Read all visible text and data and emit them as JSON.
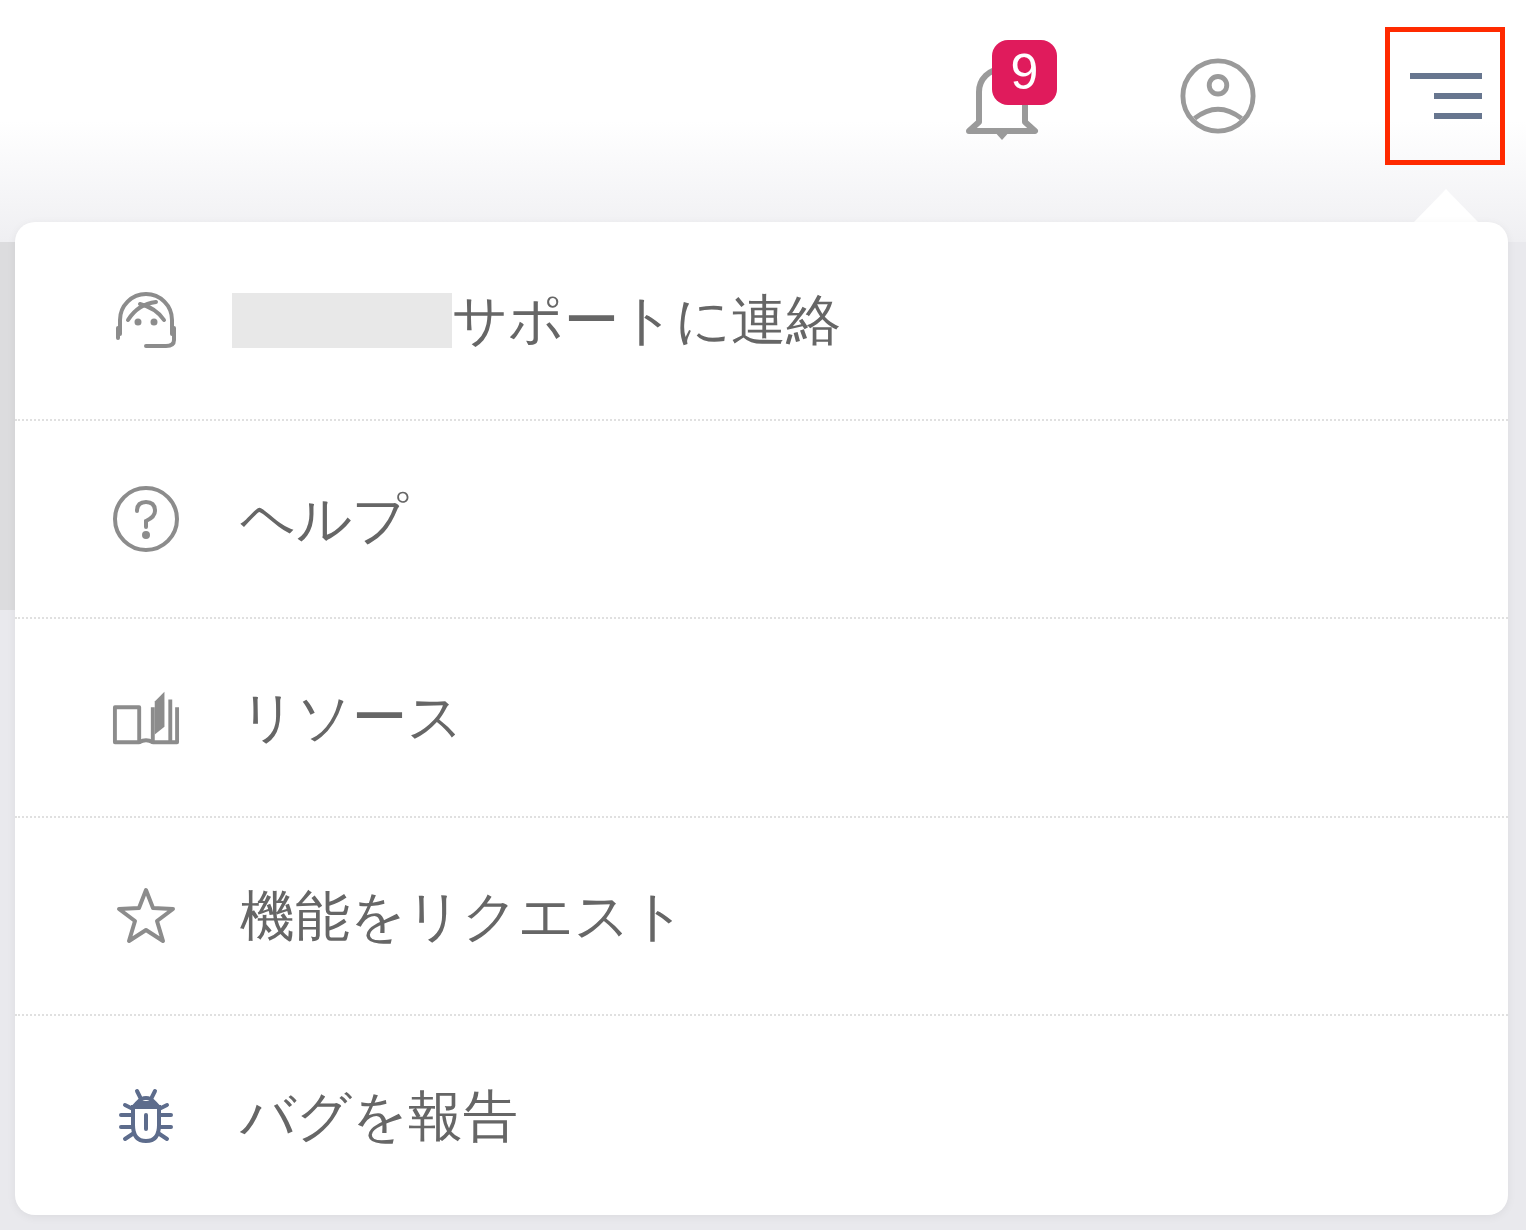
{
  "header": {
    "notification_badge": "9",
    "menu_button": {
      "highlighted": true
    }
  },
  "menu": {
    "items": [
      {
        "kind": "support",
        "label": "サポートに連絡",
        "redacted_prefix": true
      },
      {
        "kind": "help",
        "label": "ヘルプ",
        "redacted_prefix": false
      },
      {
        "kind": "resources",
        "label": "リソース",
        "redacted_prefix": false
      },
      {
        "kind": "feature",
        "label": "機能をリクエスト",
        "redacted_prefix": false
      },
      {
        "kind": "bug",
        "label": "バグを報告",
        "redacted_prefix": false
      }
    ]
  }
}
